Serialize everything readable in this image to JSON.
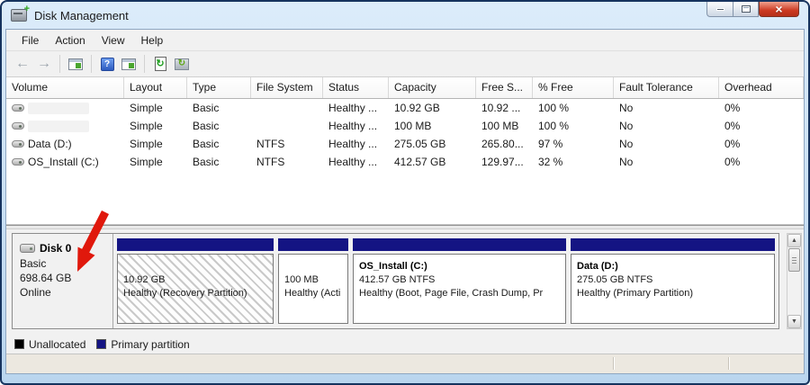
{
  "window": {
    "title": "Disk Management"
  },
  "menu": {
    "items": [
      {
        "label": "File"
      },
      {
        "label": "Action"
      },
      {
        "label": "View"
      },
      {
        "label": "Help"
      }
    ]
  },
  "toolbar": {
    "buttons": [
      {
        "icon": "back-icon"
      },
      {
        "icon": "forward-icon"
      },
      {
        "icon": "console-window-icon"
      },
      {
        "icon": "help-icon"
      },
      {
        "icon": "console-tree-icon"
      },
      {
        "icon": "refresh-icon"
      },
      {
        "icon": "rescan-disks-icon"
      }
    ]
  },
  "icons": {
    "app": "disk-management-drive-with-green-plus",
    "minimize": "dash",
    "maximize": "square",
    "close": "x",
    "volume-row": "gray-capsule-drive",
    "disk": "gray-capsule-drive",
    "scroll-up": "triangle-up",
    "scroll-down": "triangle-down"
  },
  "volume_table": {
    "columns": [
      "Volume",
      "Layout",
      "Type",
      "File System",
      "Status",
      "Capacity",
      "Free S...",
      "% Free",
      "Fault Tolerance",
      "Overhead"
    ],
    "rows": [
      {
        "volume": "",
        "layout": "Simple",
        "type": "Basic",
        "file_system": "",
        "status": "Healthy ...",
        "capacity": "10.92 GB",
        "free_space": "10.92 ...",
        "pct_free": "100 %",
        "fault_tolerance": "No",
        "overhead": "0%"
      },
      {
        "volume": "",
        "layout": "Simple",
        "type": "Basic",
        "file_system": "",
        "status": "Healthy ...",
        "capacity": "100 MB",
        "free_space": "100 MB",
        "pct_free": "100 %",
        "fault_tolerance": "No",
        "overhead": "0%"
      },
      {
        "volume": "Data (D:)",
        "layout": "Simple",
        "type": "Basic",
        "file_system": "NTFS",
        "status": "Healthy ...",
        "capacity": "275.05 GB",
        "free_space": "265.80...",
        "pct_free": "97 %",
        "fault_tolerance": "No",
        "overhead": "0%"
      },
      {
        "volume": "OS_Install (C:)",
        "layout": "Simple",
        "type": "Basic",
        "file_system": "NTFS",
        "status": "Healthy ...",
        "capacity": "412.57 GB",
        "free_space": "129.97...",
        "pct_free": "32 %",
        "fault_tolerance": "No",
        "overhead": "0%"
      }
    ]
  },
  "disk_panel": {
    "disk": {
      "name": "Disk 0",
      "type": "Basic",
      "size": "698.64 GB",
      "status": "Online"
    },
    "partitions": [
      {
        "label": "",
        "size_line": "10.92 GB",
        "status_line": "Healthy (Recovery Partition)",
        "style": "hatched"
      },
      {
        "label": "",
        "size_line": "100 MB",
        "status_line": "Healthy (Acti",
        "style": "primary"
      },
      {
        "label": "OS_Install  (C:)",
        "size_line": "412.57 GB NTFS",
        "status_line": "Healthy (Boot, Page File, Crash Dump, Pr",
        "style": "primary"
      },
      {
        "label": "Data  (D:)",
        "size_line": "275.05 GB NTFS",
        "status_line": "Healthy (Primary Partition)",
        "style": "primary"
      }
    ]
  },
  "legend": {
    "items": [
      {
        "label": "Unallocated",
        "color": "#000000"
      },
      {
        "label": "Primary partition",
        "color": "#141483"
      }
    ]
  },
  "colors": {
    "titlebar_blue": "#c5dcf0",
    "primary_partition_navy": "#141483",
    "unallocated_black": "#000000",
    "close_button_red": "#cc3a22",
    "panel_gray": "#f1f1f1",
    "annotation_arrow_red": "#e0180c"
  }
}
